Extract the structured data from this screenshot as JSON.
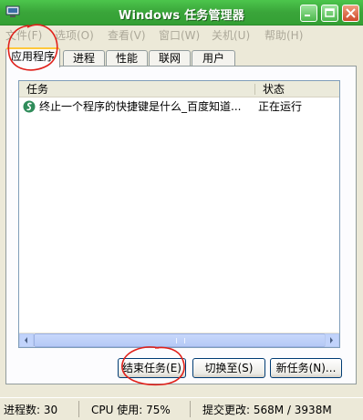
{
  "window": {
    "title": "Windows 任务管理器"
  },
  "menubar": {
    "items": [
      "文件(F)",
      "选项(O)",
      "查看(V)",
      "窗口(W)",
      "关机(U)",
      "帮助(H)"
    ]
  },
  "tabs": [
    {
      "label": "应用程序",
      "active": true
    },
    {
      "label": "进程",
      "active": false
    },
    {
      "label": "性能",
      "active": false
    },
    {
      "label": "联网",
      "active": false
    },
    {
      "label": "用户",
      "active": false
    }
  ],
  "list": {
    "columns": {
      "task": "任务",
      "status": "状态"
    },
    "rows": [
      {
        "task": "终止一个程序的快捷键是什么_百度知道...",
        "status": "正在运行",
        "icon": "browser-app-icon"
      }
    ]
  },
  "buttons": {
    "end_task": "结束任务(E)",
    "switch_to": "切换至(S)",
    "new_task": "新任务(N)..."
  },
  "status": {
    "processes": "进程数: 30",
    "cpu": "CPU 使用: 75%",
    "commit": "提交更改: 568M / 3938M"
  },
  "colors": {
    "titlebar": "#3aa53a",
    "annotation": "#e0201a",
    "active_tab_highlight": "#ffc83c"
  }
}
